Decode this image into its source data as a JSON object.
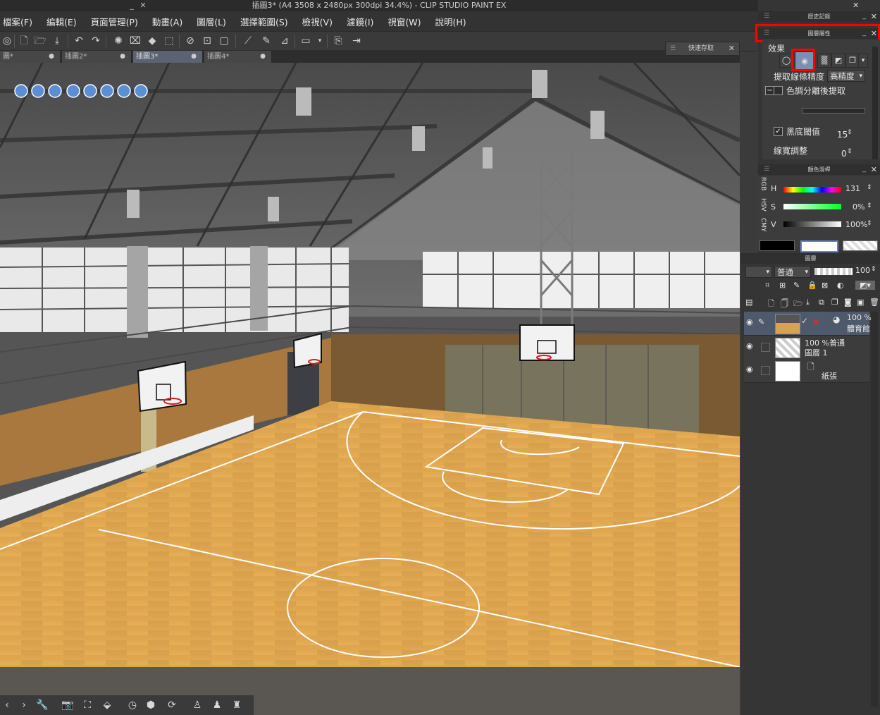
{
  "window": {
    "title": "插圖3* (A4 3508 x 2480px 300dpi 34.4%) - CLIP STUDIO PAINT EX",
    "minimize": "_",
    "close": "✕"
  },
  "menu": [
    "檔案(F)",
    "編輯(E)",
    "頁面管理(P)",
    "動畫(A)",
    "圖層(L)",
    "選擇範圍(S)",
    "檢視(V)",
    "濾鏡(I)",
    "視窗(W)",
    "說明(H)"
  ],
  "tabs": [
    {
      "label": "圖*",
      "active": false
    },
    {
      "label": "插圖2*",
      "active": false
    },
    {
      "label": "插圖3*",
      "active": true
    },
    {
      "label": "插圖4*",
      "active": false
    }
  ],
  "quick_access": {
    "title": "快速存取"
  },
  "history_panel": {
    "title": "歷史記錄"
  },
  "layer_property": {
    "title": "圖層屬性",
    "effect_label": "效果",
    "extract_precision_label": "提取線條精度",
    "extract_precision_value": "高精度",
    "tone_separation_label": "色調分離後提取",
    "tone_separation_checked": false,
    "black_threshold_label": "黑底閾值",
    "black_threshold_checked": true,
    "black_threshold_value": "15",
    "line_width_label": "線寬調整",
    "line_width_value": "0"
  },
  "color_slider": {
    "title": "顏色滑桿",
    "side_tabs": [
      "RGB",
      "HSV",
      "CMY"
    ],
    "h_label": "H",
    "h_value": "131",
    "s_label": "S",
    "s_value": "0%",
    "v_label": "V",
    "v_value": "100%"
  },
  "layer_panel": {
    "title": "圖層",
    "blend_mode": "普通",
    "opacity": "100",
    "layers": [
      {
        "opacity": "100 %",
        "name": "體育館",
        "active": true
      },
      {
        "opacity": "100 %普通",
        "name": "圖層 1",
        "active": false
      },
      {
        "opacity": "",
        "name": "紙張",
        "active": false
      }
    ]
  },
  "colors": {
    "highlight": "#ff0000",
    "active_tab": "#5b6272",
    "active_layer": "#4e596b"
  }
}
